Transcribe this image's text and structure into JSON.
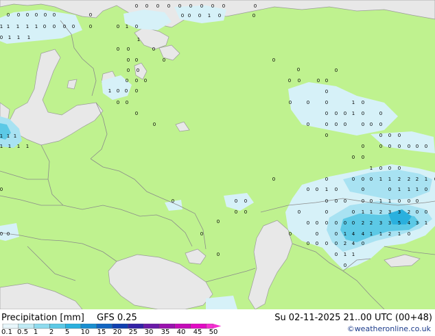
{
  "header": {
    "product": "Precipitation [mm]",
    "model": "GFS 0.25",
    "valid_time": "Su 02-11-2025 21..00 UTC (00+48)",
    "credit": "©weatheronline.co.uk"
  },
  "legend": {
    "labels": [
      "0.1",
      "0.5",
      "1",
      "2",
      "5",
      "10",
      "15",
      "20",
      "25",
      "30",
      "35",
      "40",
      "45",
      "50"
    ],
    "colors": [
      "#e8f6fb",
      "#bfeaf4",
      "#8fdbee",
      "#5cc9e6",
      "#2ab0de",
      "#1a8fd0",
      "#1266c2",
      "#1040b0",
      "#3322a6",
      "#6a1aa8",
      "#9a12ae",
      "#c40cb8",
      "#e20cc4",
      "#f52fd2"
    ]
  },
  "colors": {
    "land": "#bff28f",
    "sea": "#e8e8e8",
    "border": "#8a8a8a",
    "coast": "#9a9a9a"
  },
  "labels": [
    [
      "0",
      10,
      20
    ],
    [
      "0",
      25,
      20
    ],
    [
      "0",
      38,
      20
    ],
    [
      "0",
      51,
      20
    ],
    [
      "0",
      64,
      20
    ],
    [
      "0",
      77,
      20
    ],
    [
      "0",
      130,
      20
    ],
    [
      "0",
      197,
      7
    ],
    [
      "0",
      212,
      7
    ],
    [
      "0",
      228,
      7
    ],
    [
      "0",
      244,
      7
    ],
    [
      "0",
      260,
      7
    ],
    [
      "0",
      276,
      7
    ],
    [
      "0",
      292,
      7
    ],
    [
      "0",
      308,
      7
    ],
    [
      "0",
      324,
      7
    ],
    [
      "0",
      370,
      7
    ],
    [
      "0",
      264,
      21
    ],
    [
      "0",
      274,
      21
    ],
    [
      "0",
      289,
      21
    ],
    [
      "1",
      303,
      21
    ],
    [
      "0",
      318,
      21
    ],
    [
      "0",
      368,
      21
    ],
    [
      "1",
      0,
      37
    ],
    [
      "1",
      10,
      37
    ],
    [
      "1",
      24,
      37
    ],
    [
      "1",
      38,
      37
    ],
    [
      "1",
      51,
      37
    ],
    [
      "0",
      63,
      37
    ],
    [
      "0",
      77,
      37
    ],
    [
      "0",
      92,
      37
    ],
    [
      "0",
      105,
      37
    ],
    [
      "0",
      130,
      37
    ],
    [
      "0",
      170,
      37
    ],
    [
      "1",
      183,
      37
    ],
    [
      "0",
      197,
      37
    ],
    [
      "0",
      0,
      53
    ],
    [
      "1",
      12,
      53
    ],
    [
      "1",
      25,
      53
    ],
    [
      "1",
      40,
      53
    ],
    [
      "1",
      200,
      56
    ],
    [
      "0",
      170,
      70
    ],
    [
      "0",
      185,
      70
    ],
    [
      "0",
      222,
      70
    ],
    [
      "0",
      185,
      86
    ],
    [
      "0",
      197,
      86
    ],
    [
      "0",
      237,
      86
    ],
    [
      "0",
      397,
      86
    ],
    [
      "0",
      185,
      101
    ],
    [
      "0",
      199,
      101
    ],
    [
      "0",
      433,
      100
    ],
    [
      "0",
      488,
      101
    ],
    [
      "0",
      183,
      116
    ],
    [
      "0",
      197,
      116
    ],
    [
      "0",
      210,
      116
    ],
    [
      "0",
      420,
      116
    ],
    [
      "0",
      434,
      116
    ],
    [
      "0",
      462,
      116
    ],
    [
      "0",
      474,
      116
    ],
    [
      "1",
      158,
      131
    ],
    [
      "0",
      170,
      131
    ],
    [
      "0",
      182,
      131
    ],
    [
      "0",
      197,
      131
    ],
    [
      "0",
      474,
      132
    ],
    [
      "0",
      170,
      148
    ],
    [
      "0",
      183,
      148
    ],
    [
      "0",
      421,
      148
    ],
    [
      "0",
      447,
      148
    ],
    [
      "0",
      474,
      148
    ],
    [
      "1",
      513,
      148
    ],
    [
      "0",
      527,
      148
    ],
    [
      "0",
      197,
      164
    ],
    [
      "0",
      474,
      164
    ],
    [
      "0",
      488,
      164
    ],
    [
      "0",
      501,
      164
    ],
    [
      "1",
      513,
      164
    ],
    [
      "0",
      527,
      164
    ],
    [
      "0",
      553,
      164
    ],
    [
      "0",
      223,
      180
    ],
    [
      "0",
      447,
      180
    ],
    [
      "0",
      474,
      180
    ],
    [
      "0",
      488,
      180
    ],
    [
      "0",
      501,
      180
    ],
    [
      "0",
      527,
      180
    ],
    [
      "0",
      539,
      180
    ],
    [
      "0",
      553,
      180
    ],
    [
      "1",
      0,
      197
    ],
    [
      "1",
      10,
      197
    ],
    [
      "1",
      20,
      197
    ],
    [
      "0",
      474,
      196
    ],
    [
      "0",
      553,
      196
    ],
    [
      "0",
      566,
      196
    ],
    [
      "0",
      580,
      196
    ],
    [
      "1",
      0,
      212
    ],
    [
      "1",
      12,
      212
    ],
    [
      "1",
      25,
      212
    ],
    [
      "1",
      38,
      212
    ],
    [
      "0",
      527,
      212
    ],
    [
      "0",
      553,
      212
    ],
    [
      "0",
      566,
      212
    ],
    [
      "0",
      580,
      212
    ],
    [
      "0",
      594,
      212
    ],
    [
      "0",
      606,
      212
    ],
    [
      "0",
      619,
      212
    ],
    [
      "0",
      513,
      228
    ],
    [
      "0",
      527,
      228
    ],
    [
      "1",
      539,
      244
    ],
    [
      "0",
      553,
      244
    ],
    [
      "0",
      566,
      244
    ],
    [
      "0",
      580,
      244
    ],
    [
      "0",
      397,
      260
    ],
    [
      "0",
      474,
      260
    ],
    [
      "0",
      513,
      260
    ],
    [
      "0",
      527,
      260
    ],
    [
      "0",
      539,
      260
    ],
    [
      "1",
      553,
      260
    ],
    [
      "1",
      566,
      260
    ],
    [
      "2",
      580,
      260
    ],
    [
      "2",
      594,
      260
    ],
    [
      "2",
      606,
      260
    ],
    [
      "1",
      619,
      260
    ],
    [
      "0",
      633,
      260
    ],
    [
      "0",
      0,
      275
    ],
    [
      "0",
      447,
      275
    ],
    [
      "0",
      460,
      275
    ],
    [
      "1",
      474,
      275
    ],
    [
      "0",
      488,
      275
    ],
    [
      "0",
      527,
      275
    ],
    [
      "0",
      566,
      275
    ],
    [
      "1",
      580,
      275
    ],
    [
      "1",
      594,
      275
    ],
    [
      "1",
      606,
      275
    ],
    [
      "0",
      619,
      275
    ],
    [
      "0",
      250,
      292
    ],
    [
      "0",
      342,
      292
    ],
    [
      "0",
      356,
      292
    ],
    [
      "0",
      474,
      292
    ],
    [
      "0",
      488,
      292
    ],
    [
      "0",
      501,
      292
    ],
    [
      "0",
      527,
      292
    ],
    [
      "0",
      539,
      292
    ],
    [
      "1",
      553,
      292
    ],
    [
      "1",
      566,
      292
    ],
    [
      "0",
      580,
      292
    ],
    [
      "0",
      594,
      292
    ],
    [
      "0",
      606,
      292
    ],
    [
      "0",
      342,
      308
    ],
    [
      "0",
      356,
      308
    ],
    [
      "0",
      434,
      308
    ],
    [
      "0",
      474,
      308
    ],
    [
      "0",
      513,
      308
    ],
    [
      "1",
      527,
      308
    ],
    [
      "1",
      539,
      308
    ],
    [
      "2",
      553,
      308
    ],
    [
      "3",
      566,
      308
    ],
    [
      "3",
      580,
      308
    ],
    [
      "2",
      594,
      308
    ],
    [
      "0",
      606,
      308
    ],
    [
      "0",
      619,
      308
    ],
    [
      "0",
      316,
      322
    ],
    [
      "0",
      447,
      324
    ],
    [
      "0",
      460,
      324
    ],
    [
      "0",
      474,
      324
    ],
    [
      "0",
      488,
      324
    ],
    [
      "0",
      501,
      324
    ],
    [
      "0",
      513,
      324
    ],
    [
      "2",
      527,
      324
    ],
    [
      "2",
      539,
      324
    ],
    [
      "3",
      553,
      324
    ],
    [
      "3",
      566,
      324
    ],
    [
      "5",
      580,
      324
    ],
    [
      "4",
      594,
      324
    ],
    [
      "3",
      606,
      324
    ],
    [
      "1",
      619,
      324
    ],
    [
      "0",
      0,
      340
    ],
    [
      "0",
      10,
      340
    ],
    [
      "0",
      292,
      340
    ],
    [
      "0",
      421,
      340
    ],
    [
      "0",
      460,
      340
    ],
    [
      "0",
      488,
      340
    ],
    [
      "1",
      501,
      340
    ],
    [
      "4",
      513,
      340
    ],
    [
      "4",
      527,
      340
    ],
    [
      "1",
      539,
      340
    ],
    [
      "1",
      553,
      340
    ],
    [
      "2",
      566,
      340
    ],
    [
      "1",
      580,
      340
    ],
    [
      "0",
      594,
      340
    ],
    [
      "0",
      447,
      354
    ],
    [
      "0",
      460,
      354
    ],
    [
      "0",
      474,
      354
    ],
    [
      "0",
      488,
      354
    ],
    [
      "2",
      501,
      354
    ],
    [
      "4",
      513,
      354
    ],
    [
      "0",
      527,
      354
    ],
    [
      "0",
      316,
      370
    ],
    [
      "0",
      488,
      370
    ],
    [
      "1",
      501,
      370
    ],
    [
      "1",
      513,
      370
    ],
    [
      "0",
      501,
      386
    ]
  ],
  "map_title_attr": "Precipitation map"
}
